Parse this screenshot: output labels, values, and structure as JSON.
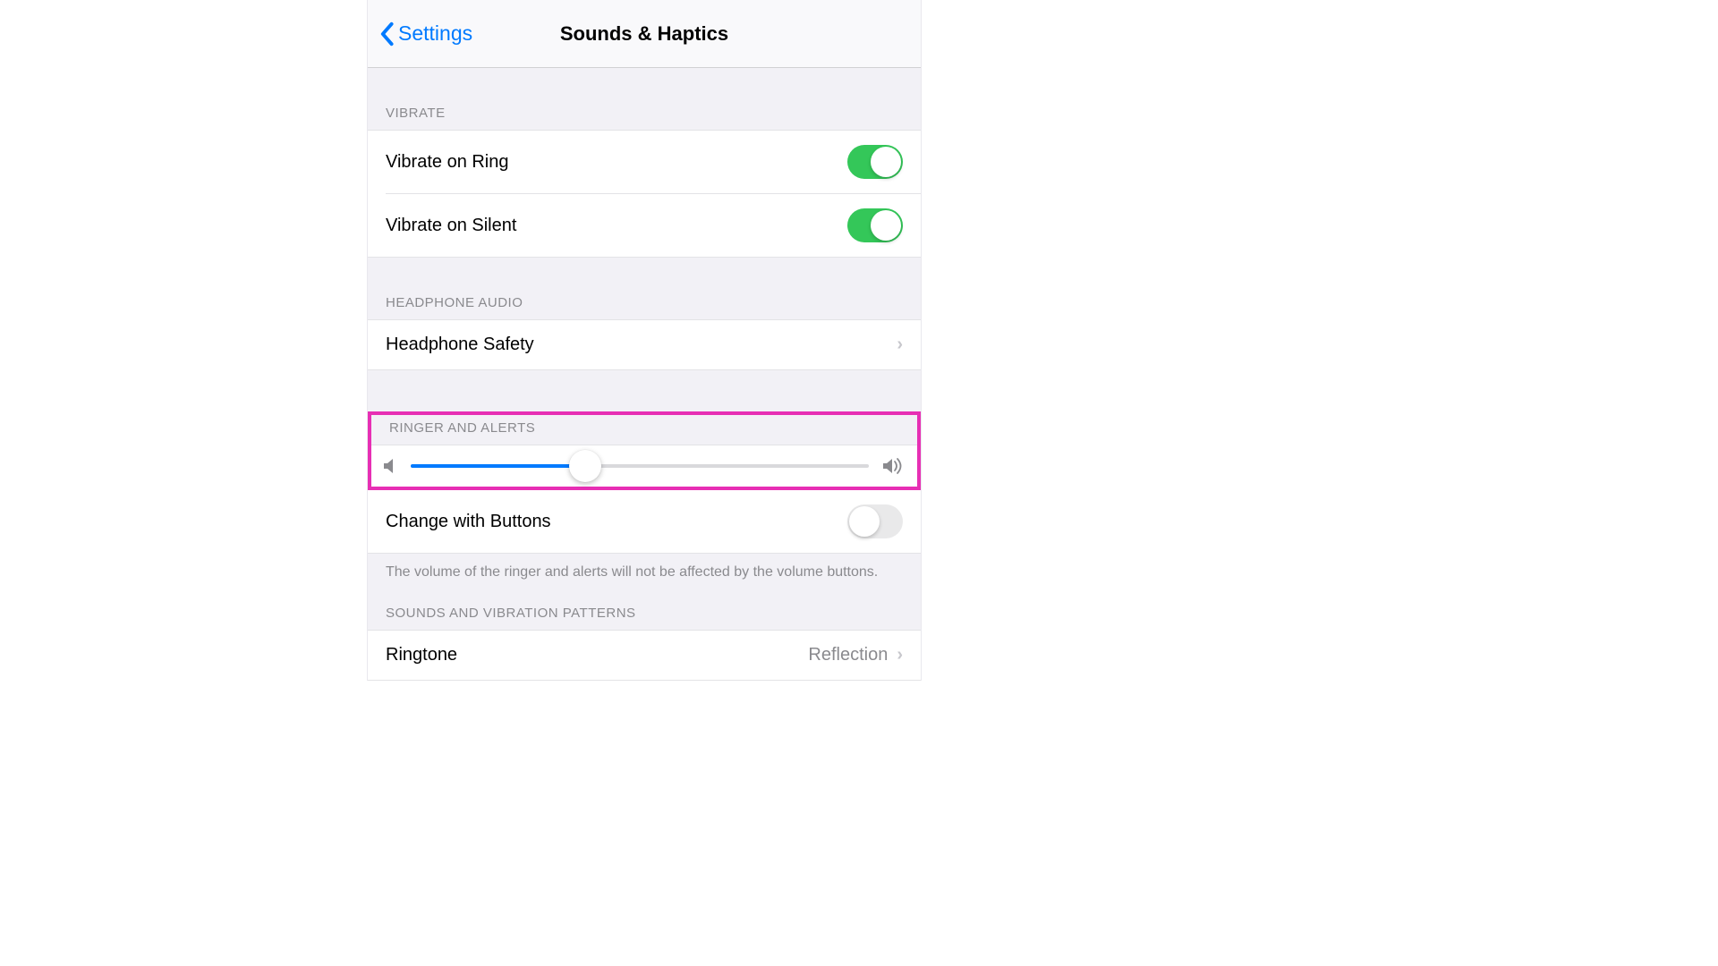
{
  "nav": {
    "back": "Settings",
    "title": "Sounds & Haptics"
  },
  "sections": {
    "vibrate": {
      "header": "VIBRATE",
      "ring": "Vibrate on Ring",
      "silent": "Vibrate on Silent"
    },
    "headphone": {
      "header": "HEADPHONE AUDIO",
      "safety": "Headphone Safety"
    },
    "ringer": {
      "header": "RINGER AND ALERTS",
      "change": "Change with Buttons",
      "footer": "The volume of the ringer and alerts will not be affected by the volume buttons.",
      "slider_percent": 38
    },
    "patterns": {
      "header": "SOUNDS AND VIBRATION PATTERNS",
      "ringtone": "Ringtone",
      "ringtone_value": "Reflection"
    }
  }
}
